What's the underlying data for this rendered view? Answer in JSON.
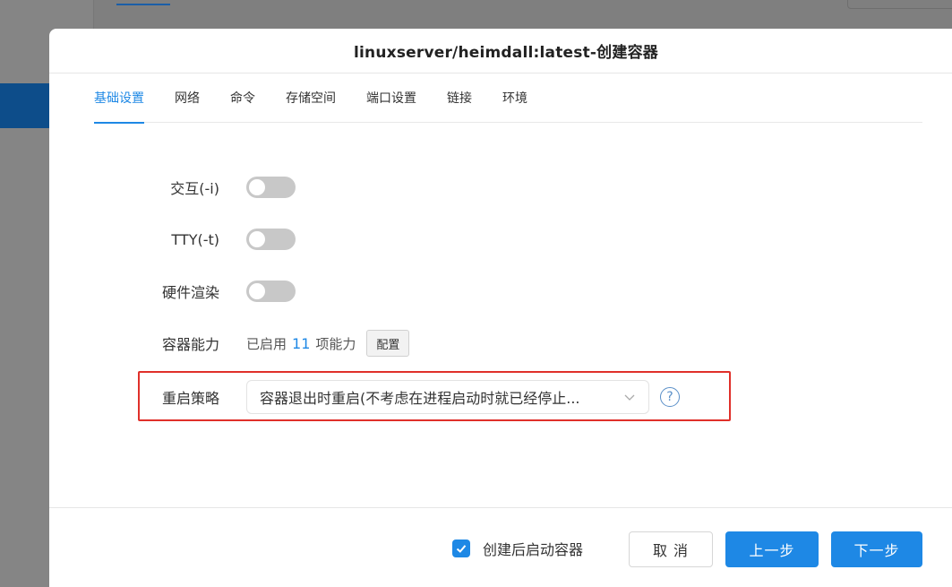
{
  "dialog": {
    "title": "linuxserver/heimdall:latest-创建容器"
  },
  "tabs": [
    {
      "label": "基础设置",
      "active": true
    },
    {
      "label": "网络"
    },
    {
      "label": "命令"
    },
    {
      "label": "存储空间"
    },
    {
      "label": "端口设置"
    },
    {
      "label": "链接"
    },
    {
      "label": "环境"
    }
  ],
  "form": {
    "interactive": {
      "label": "交互(-i)",
      "enabled": false
    },
    "tty": {
      "label": "TTY(-t)",
      "enabled": false
    },
    "hw_render": {
      "label": "硬件渲染",
      "enabled": false
    },
    "capabilities": {
      "label": "容器能力",
      "prefix": "已启用",
      "count": "11",
      "suffix": "项能力",
      "config_button": "配置"
    },
    "restart_policy": {
      "label": "重启策略",
      "value": "容器退出时重启(不考虑在进程启动时就已经停止..."
    }
  },
  "footer": {
    "autostart_label": "创建后启动容器",
    "autostart_checked": true,
    "cancel": "取 消",
    "prev": "上一步",
    "next": "下一步"
  },
  "colors": {
    "accent": "#1e88e5",
    "highlight": "#e0302a"
  }
}
